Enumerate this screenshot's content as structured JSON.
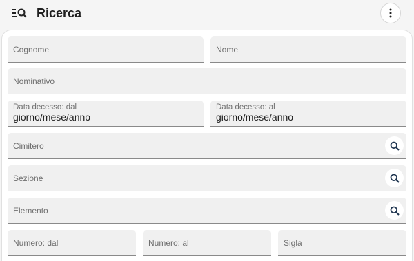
{
  "header": {
    "title": "Ricerca",
    "menu_icon": "filter-search-icon",
    "more_icon": "more-vert-icon"
  },
  "form": {
    "cognome": {
      "label": "Cognome"
    },
    "nome": {
      "label": "Nome"
    },
    "nominativo": {
      "label": "Nominativo"
    },
    "data_decesso_dal": {
      "label": "Data decesso: dal",
      "value": "giorno/mese/anno"
    },
    "data_decesso_al": {
      "label": "Data decesso: al",
      "value": "giorno/mese/anno"
    },
    "cimitero": {
      "label": "Cimitero",
      "icon": "search-icon"
    },
    "sezione": {
      "label": "Sezione",
      "icon": "search-icon"
    },
    "elemento": {
      "label": "Elemento",
      "icon": "search-icon"
    },
    "numero_dal": {
      "label": "Numero: dal"
    },
    "numero_al": {
      "label": "Numero: al"
    },
    "sigla": {
      "label": "Sigla"
    }
  },
  "colors": {
    "background": "#f5f5f5",
    "card": "#ffffff",
    "field": "#f0f0f0",
    "icon": "#1f3550"
  }
}
